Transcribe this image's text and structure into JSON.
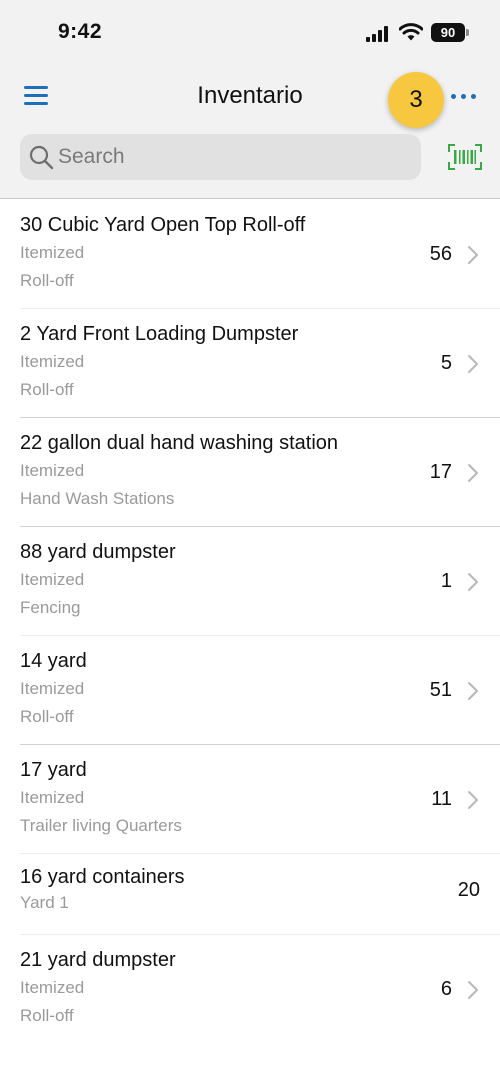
{
  "status_bar": {
    "time": "9:42",
    "battery": "90"
  },
  "header": {
    "title": "Inventario",
    "badge_count": "3"
  },
  "search": {
    "placeholder": "Search",
    "value": ""
  },
  "colors": {
    "accent": "#1e6fb8",
    "badge": "#f6c73f",
    "barcode": "#3aa847"
  },
  "icons": {
    "menu": "hamburger-menu-icon",
    "more": "ellipsis-icon",
    "search": "magnifier-icon",
    "scan": "barcode-icon",
    "chevron": "chevron-right-icon"
  },
  "items": [
    {
      "name": "30 Cubic Yard Open Top Roll-off",
      "type": "Itemized",
      "category": "Roll-off",
      "count": "56"
    },
    {
      "name": "2 Yard Front Loading Dumpster",
      "type": "Itemized",
      "category": "Roll-off",
      "count": "5"
    },
    {
      "name": "22 gallon dual hand washing station",
      "type": "Itemized",
      "category": "Hand Wash Stations",
      "count": "17"
    },
    {
      "name": "88 yard dumpster",
      "type": "Itemized",
      "category": "Fencing",
      "count": "1"
    },
    {
      "name": "14 yard",
      "type": "Itemized",
      "category": "Roll-off",
      "count": "51"
    },
    {
      "name": "17 yard",
      "type": "Itemized",
      "category": "Trailer living Quarters",
      "count": "11"
    },
    {
      "name": "16 yard containers",
      "type": "Yard 1",
      "count": "20"
    },
    {
      "name": "21 yard dumpster",
      "type": "Itemized",
      "category": "Roll-off",
      "count": "6"
    }
  ]
}
